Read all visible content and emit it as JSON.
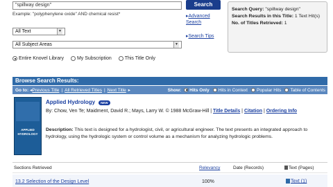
{
  "search": {
    "query_value": "\"spillway design\"",
    "example_text": "Example: \"polyphenylene oxide\" AND chemical resist*",
    "button_label": "Search",
    "advanced_label": "Advanced Search",
    "search_tips_label": "Search Tips",
    "scope_select": "All Text",
    "subject_select": "All Subject Areas",
    "radios": [
      {
        "label": "Entire Knovel Library",
        "selected": true
      },
      {
        "label": "My Subscription",
        "selected": false
      },
      {
        "label": "This Title Only",
        "selected": false
      }
    ]
  },
  "summary": {
    "line1_label": "Search Query:",
    "line1_value": "\"spillway design\"",
    "line2_label": "Search Results in this Title:",
    "line2_value": "1 Text Hit(s)",
    "line3_label": "No. of Titles Retrieved:",
    "line3_value": "1"
  },
  "results": {
    "bar_title": "Browse Search Results:",
    "goto_label": "Go to:",
    "prev_title": "Previous Title",
    "all_retrieved": "All Retrieved Titles",
    "next_title": "Next Title",
    "show_label": "Show:",
    "show_options": [
      "Hits Only",
      "Hits in Context",
      "Popular Hits",
      "Table of Contents"
    ]
  },
  "book": {
    "title": "Applied Hydrology",
    "new_badge": "NEW",
    "byline": "By: Chow, Ven Te; Maidment, David R.; Mays, Larry W. © 1988 McGraw-Hill |",
    "title_details": "Title Details",
    "citation": "Citation",
    "ordering_info": "Ordering Info",
    "description_label": "Description:",
    "description": "This text is designed for a hydrologist, civil, or agricultural engineer. The text presents an integrated approach to hydrology, using the hydrologic system or control volume as a mechanism for analyzing hydrologic problems.",
    "cover_line1": "APPLIED",
    "cover_line2": "HYDROLOGY",
    "cover_color": "#1d5d98"
  },
  "table": {
    "col_sections": "Sections Retrieved",
    "col_relevancy": "Relevancy",
    "col_date": "Date (Records)",
    "col_text": "Text (Pages)",
    "rows": [
      {
        "section": "13.2 Selection of the Design Level",
        "relevancy": "100%",
        "text": "Text (1)"
      }
    ]
  }
}
